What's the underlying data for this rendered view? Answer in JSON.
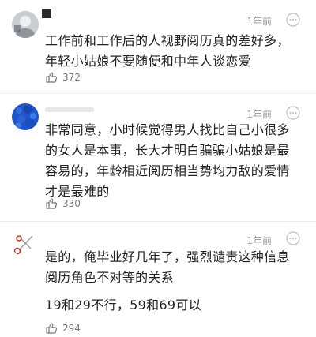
{
  "comments": [
    {
      "username": "",
      "time": "1年前",
      "text": "工作前和工作后的人视野阅历真的差好多，年轻小姑娘不要随便和中年人谈恋爱",
      "likes": "372"
    },
    {
      "username": "",
      "time": "1年前",
      "text": "非常同意，小时候觉得男人找比自己小很多的女人是本事，长大才明白骗骗小姑娘是最容易的，年龄相近阅历相当势均力敌的爱情才是最难的",
      "likes": "330"
    },
    {
      "username": "",
      "time": "1年前",
      "text": "是的，俺毕业好几年了，强烈谴责这种信息阅历角色不对等的关系",
      "text_extra": "19和29不行，59和69可以",
      "likes": "294"
    }
  ],
  "icons": {
    "like": "thumbs-up-icon",
    "more": "more-circle-icon"
  }
}
